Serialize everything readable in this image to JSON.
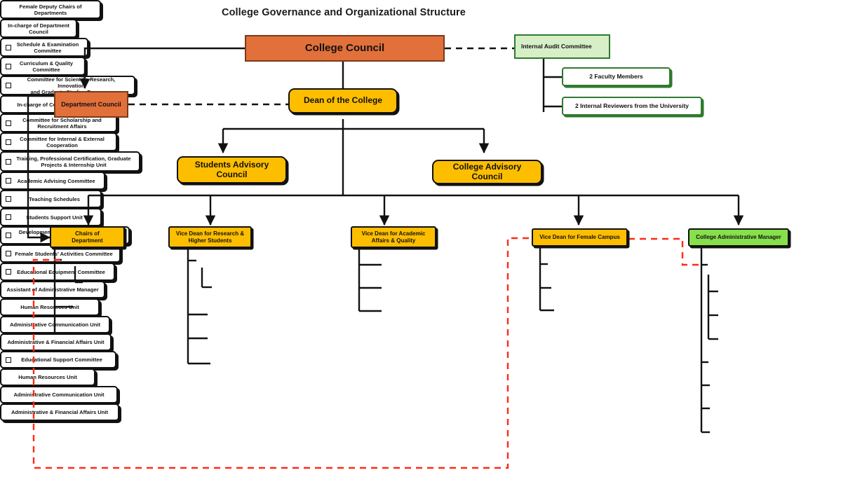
{
  "title": "College Governance and Organizational Structure",
  "colors": {
    "council_fill": "#e2703a",
    "council_border": "#7a3a1a",
    "amber_fill": "#fdbe00",
    "green_header_fill": "#d6efc7",
    "green_border": "#2f7a2f",
    "manager_fill": "#86e04b",
    "leaf_fill": "#ffffff",
    "line": "#111111",
    "dashed_red": "#ff2a17"
  },
  "top": {
    "college_council": "College Council",
    "department_council": "Department Council",
    "dean": "Dean of the College",
    "students_advisory_council": "Students Advisory\nCouncil",
    "students_advisory_line1": "Students Advisory",
    "students_advisory_line2": "Council",
    "college_advisory_council": "College Advisory Council"
  },
  "audit": {
    "header": "Internal Audit Committee",
    "members": [
      "2 Faculty Members",
      "2 Internal Reviewers  from the University"
    ]
  },
  "branches": [
    {
      "id": "chairs-of-department",
      "header_line1": "Chairs of",
      "header_line2": "Department",
      "children": [
        {
          "label_line1": "Female Deputy  Chairs of",
          "label_line2": "Departments",
          "checkbox": false
        },
        {
          "label_line1": "In-charge of Department",
          "label_line2": "Council",
          "checkbox": false
        },
        {
          "label_line1": "Schedule & Examination",
          "label_line2": "Committee",
          "checkbox": true
        },
        {
          "label_line1": "Curriculum & Quality",
          "label_line2": "Committee",
          "checkbox": true
        }
      ]
    },
    {
      "id": "vice-dean-research",
      "header_line1": "Vice Dean for Research &",
      "header_line2": "Higher Students",
      "children": [
        {
          "label_line1": "Committee for Scientific Research, Innovation",
          "label_line2": "and Graduate Studies Programs",
          "checkbox": true
        },
        {
          "label_line1": "In-charge of College Council",
          "label_line2": "",
          "checkbox": false
        },
        {
          "label_line1": "Committee for Scholarship and",
          "label_line2": "Recruitment Affairs",
          "checkbox": true
        },
        {
          "label_line1": "Committee for Internal & External",
          "label_line2": "Cooperation",
          "checkbox": true
        },
        {
          "label_line1": "Training, Professional Certification, Graduate",
          "label_line2": "Projects & Internship Unit",
          "checkbox": true
        }
      ]
    },
    {
      "id": "vice-dean-academic",
      "header_line1": "Vice Dean for Academic",
      "header_line2": "Affairs & Quality",
      "children": [
        {
          "label_line1": "Academic Advising Committee",
          "label_line2": "",
          "checkbox": true
        },
        {
          "label_line1": "Teaching Schedules",
          "label_line2": "",
          "checkbox": true
        },
        {
          "label_line1": "Students Support Unit",
          "label_line2": "",
          "checkbox": true
        }
      ]
    },
    {
      "id": "vice-dean-female-campus",
      "header_line1": "Vice Dean for Female Campus",
      "header_line2": "",
      "children": [
        {
          "label_line1": "Development and Quality & Curriculum Unit",
          "label_line2": "",
          "checkbox": true
        },
        {
          "label_line1": "Female Students' Activities Committee",
          "label_line2": "",
          "checkbox": true
        },
        {
          "label_line1": "Educational Equipment  Committee",
          "label_line2": "",
          "checkbox": true
        }
      ]
    },
    {
      "id": "college-administrative-manager",
      "header_line1": "College Administrative Manager",
      "header_line2": "",
      "children": [
        {
          "label_line1": "Assistant of Administrative Manager",
          "label_line2": "",
          "checkbox": false
        },
        {
          "label_line1": "Human Resources Unit",
          "label_line2": "",
          "checkbox": false
        },
        {
          "label_line1": "Administrative Communication Unit",
          "label_line2": "",
          "checkbox": false
        },
        {
          "label_line1": "Administrative & Financial Affairs Unit",
          "label_line2": "",
          "checkbox": false
        },
        {
          "label_line1": "Educational Support  Committee",
          "label_line2": "",
          "checkbox": true
        },
        {
          "label_line1": "Human Resources Unit",
          "label_line2": "",
          "checkbox": false
        },
        {
          "label_line1": "Administrative Communication Unit",
          "label_line2": "",
          "checkbox": false
        },
        {
          "label_line1": "Administrative & Financial Affairs Unit",
          "label_line2": "",
          "checkbox": false
        }
      ]
    }
  ]
}
